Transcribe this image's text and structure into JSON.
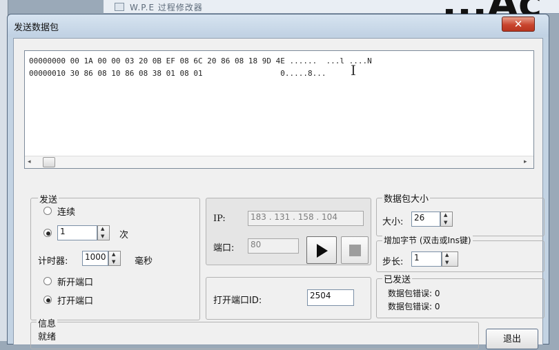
{
  "background": {
    "window_title": "W.P.E 过程修改器",
    "big_text": "...Ac",
    "left_edge": ""
  },
  "dialog": {
    "title": "发送数据包",
    "close_label": "✕"
  },
  "hex_view": {
    "lines": [
      "00000000 00 1A 00 00 03 20 0B EF 08 6C 20 86 08 18 9D 4E ......  ...l ....N",
      "00000010 30 86 08 10 86 08 38 01 08 01                 0.....8..."
    ],
    "cursor_glyph": "I"
  },
  "send_group": {
    "legend": "发送",
    "continuous_label": "连续",
    "count_value": "1",
    "count_unit": "次",
    "timer_label": "计时器:",
    "timer_value": "1000",
    "timer_unit": "毫秒",
    "new_port_label": "新开端口",
    "open_port_label": "打开端口"
  },
  "ip_group": {
    "ip_label": "IP:",
    "ip_value": "183 . 131 . 158 . 104",
    "port_label": "端口:",
    "port_value": "80"
  },
  "open_port_group": {
    "label": "打开端口ID:",
    "value": "2504"
  },
  "size_group": {
    "legend": "数据包大小",
    "size_label": "大小:",
    "size_value": "26"
  },
  "increment_group": {
    "legend": "增加字节 (双击或Ins键)",
    "step_label": "步长:",
    "step_value": "1"
  },
  "sent_group": {
    "legend": "已发送",
    "packet_error_1": "数据包错误: 0",
    "packet_error_2": "数据包错误: 0"
  },
  "info_group": {
    "legend": "信息",
    "text": "就绪"
  },
  "exit_label": "退出"
}
